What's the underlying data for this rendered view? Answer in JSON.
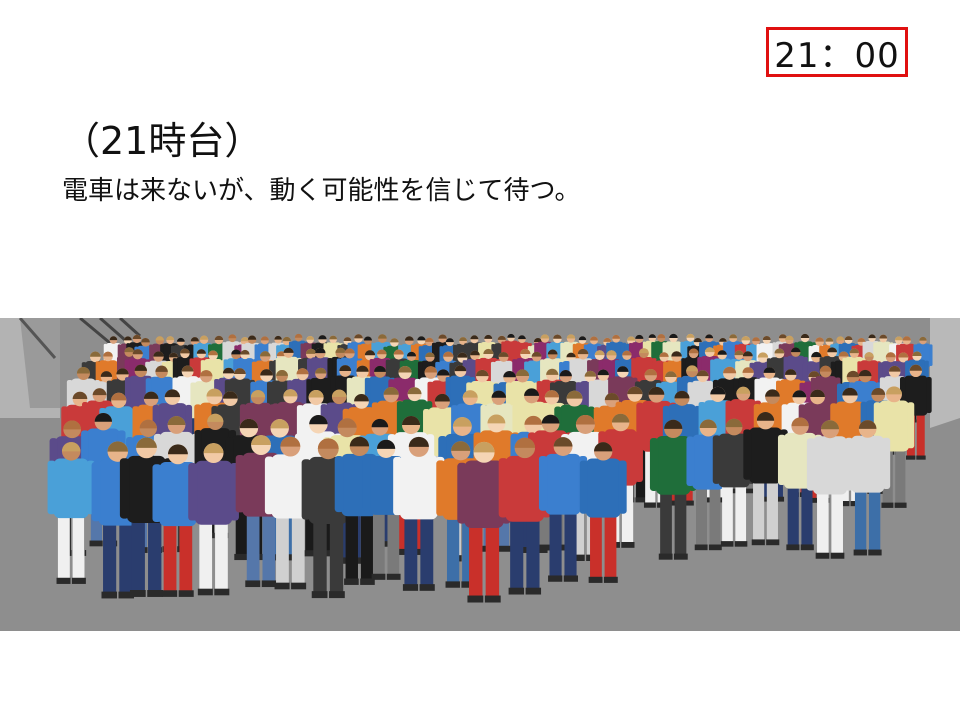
{
  "time_label": "21：00",
  "heading": "（21時台）",
  "caption": "電車は来ないが、動く可能性を信じて待つ。",
  "scene": {
    "subject": "crowd-simulation",
    "colors": {
      "floor": "#8e8e8e",
      "wall": "#b9b9b9",
      "highlight": "#e01010"
    }
  }
}
